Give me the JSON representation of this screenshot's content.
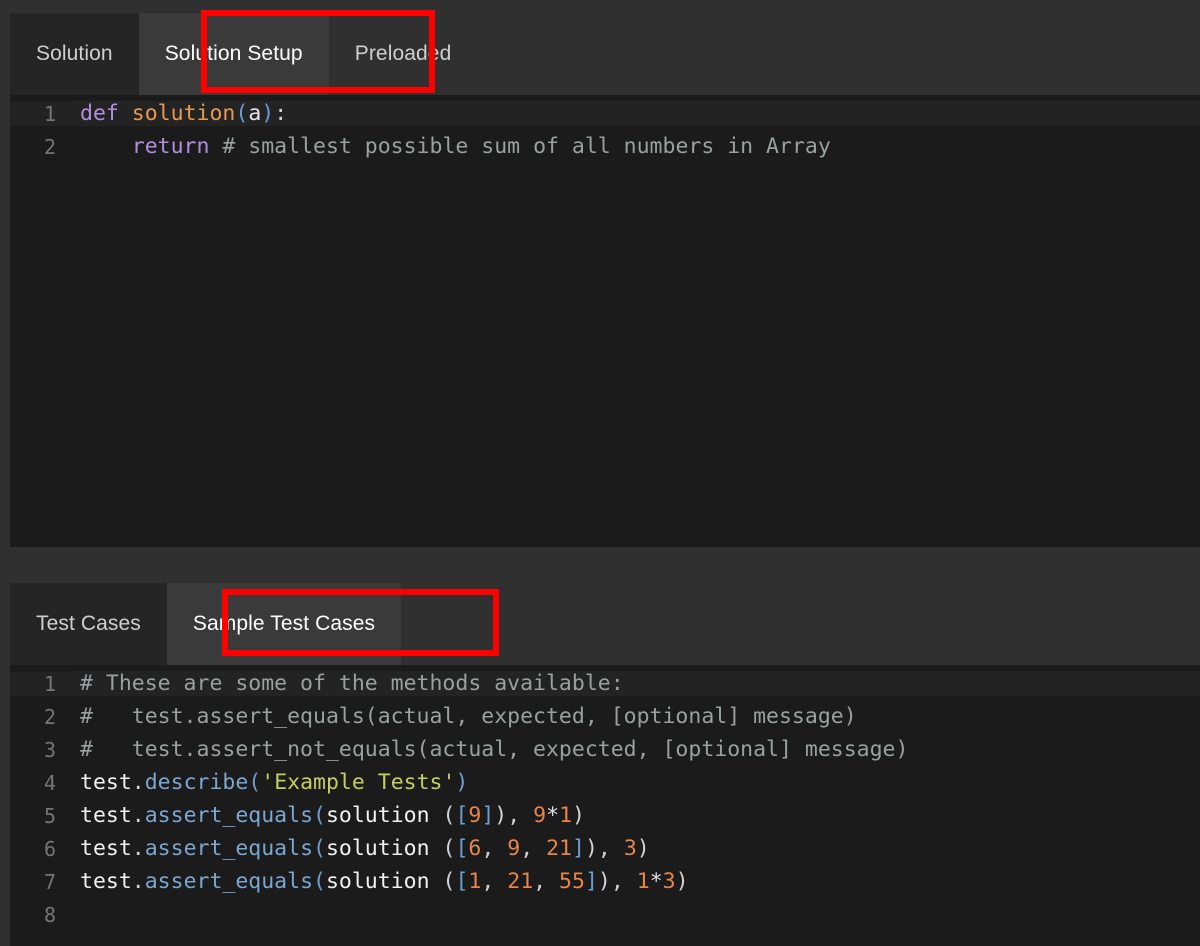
{
  "window": {
    "background_color": "#303030",
    "editor_background": "#1b1b1b",
    "tab_inactive_color": "#252525",
    "tab_active_color": "#3a3a3a",
    "annotation_color": "#fe0000"
  },
  "solution_panel": {
    "tabs": [
      {
        "label": "Solution",
        "active": false
      },
      {
        "label": "Solution Setup",
        "active": true
      },
      {
        "label": "Preloaded",
        "active": false
      }
    ],
    "editor": {
      "language": "python",
      "active_line": 1,
      "lines": [
        {
          "number": "1",
          "text": "def solution(a):"
        },
        {
          "number": "2",
          "text": "    return # smallest possible sum of all numbers in Array"
        }
      ]
    }
  },
  "test_panel": {
    "tabs": [
      {
        "label": "Test Cases",
        "active": false
      },
      {
        "label": "Sample Test Cases",
        "active": true
      }
    ],
    "editor": {
      "language": "python",
      "active_line": 1,
      "lines": [
        {
          "number": "1",
          "text": "# These are some of the methods available:"
        },
        {
          "number": "2",
          "text": "#   test.assert_equals(actual, expected, [optional] message)"
        },
        {
          "number": "3",
          "text": "#   test.assert_not_equals(actual, expected, [optional] message)"
        },
        {
          "number": "4",
          "text": "test.describe('Example Tests')"
        },
        {
          "number": "5",
          "text": "test.assert_equals(solution ([9]), 9*1)"
        },
        {
          "number": "6",
          "text": "test.assert_equals(solution ([6, 9, 21]), 3)"
        },
        {
          "number": "7",
          "text": "test.assert_equals(solution ([1, 21, 55]), 1*3)"
        },
        {
          "number": "8",
          "text": ""
        }
      ]
    }
  },
  "annotations": [
    {
      "target": "Solution Setup"
    },
    {
      "target": "Sample Test Cases"
    }
  ]
}
